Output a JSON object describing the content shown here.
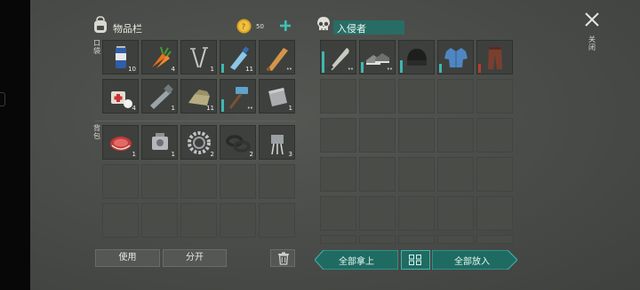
{
  "inventory": {
    "title": "物品栏",
    "coin_count": "50",
    "pockets_label": "口袋",
    "backpack_label": "背包",
    "use_label": "使用",
    "split_label": "分开"
  },
  "invader": {
    "title": "入侵者",
    "take_all_label": "全部拿上",
    "put_all_label": "全部放入"
  },
  "close_label": "关闭",
  "pocket_items": [
    {
      "icon": "soda-can-icon",
      "count": "10"
    },
    {
      "icon": "carrot-icon",
      "count": "4"
    },
    {
      "icon": "nails-icon",
      "count": "1"
    },
    {
      "icon": "water-bottle-icon",
      "count": "11"
    },
    {
      "icon": "baseball-bat-icon",
      "count": "••"
    },
    {
      "icon": "medkit-icon",
      "count": "4"
    },
    {
      "icon": "pipe-icon",
      "count": "1"
    },
    {
      "icon": "cloth-icon",
      "count": "11"
    },
    {
      "icon": "sledgehammer-icon",
      "count": "••"
    },
    {
      "icon": "metal-plate-icon",
      "count": "1"
    }
  ],
  "backpack_items": [
    {
      "icon": "meat-icon",
      "count": "1"
    },
    {
      "icon": "engine-part-icon",
      "count": "1"
    },
    {
      "icon": "gear-ring-icon",
      "count": "2"
    },
    {
      "icon": "rubber-ring-icon",
      "count": "2"
    },
    {
      "icon": "electronic-part-icon",
      "count": "3"
    }
  ],
  "invader_items": [
    {
      "icon": "machete-icon",
      "count": "••"
    },
    {
      "icon": "sneakers-icon",
      "count": "••"
    },
    {
      "icon": "beanie-icon",
      "count": ""
    },
    {
      "icon": "shirt-icon",
      "count": ""
    },
    {
      "icon": "pants-icon",
      "count": ""
    }
  ],
  "colors": {
    "accent": "#3fb6b0",
    "teal_button": "#1f6b62",
    "background": "#4a4c49"
  }
}
